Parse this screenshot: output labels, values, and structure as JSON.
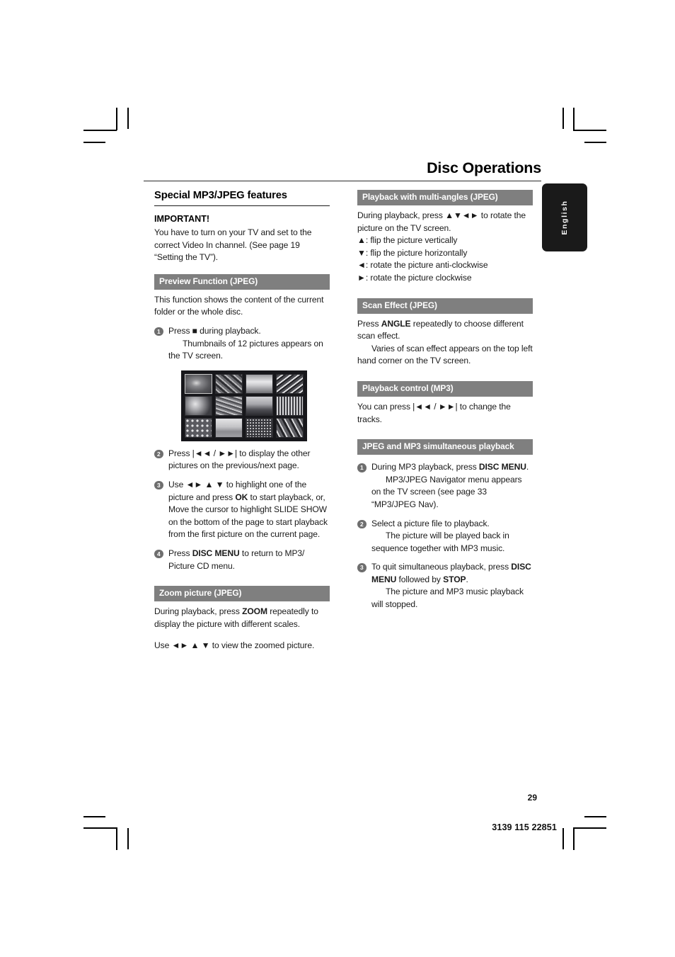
{
  "header": {
    "title": "Disc Operations",
    "language_tab": "English"
  },
  "left_column": {
    "main_title": "Special MP3/JPEG features",
    "important": {
      "heading": "IMPORTANT!",
      "text": "You have to turn on your TV and set to the correct Video In channel.  (See page 19 “Setting the TV”)."
    },
    "preview": {
      "bar": "Preview Function (JPEG)",
      "intro": "This function shows the content of the current folder or the whole disc.",
      "step1_num": "1",
      "step1_main": "Press ■ during playback.",
      "step1_cont": "Thumbnails of 12 pictures appears on",
      "step1_cont2": "the TV screen.",
      "step2_num": "2",
      "step2_text": "Press |◄◄ / ►►| to display the other pictures on the previous/next page.",
      "step3_num": "3",
      "step3_a": "Use ◄► ▲ ▼ to highlight one of the picture and press OK to start playback, or,",
      "step3_b": "Move the cursor to highlight SLIDE SHOW on the bottom of the page to start playback from the first picture on the current page.",
      "step4_num": "4",
      "step4_text": "Press DISC MENU to return to MP3/ Picture CD menu."
    },
    "zoom": {
      "bar": "Zoom picture (JPEG)",
      "text1": "During playback, press ZOOM repeatedly to display the picture with different scales.",
      "text2": "Use ◄► ▲ ▼ to view the zoomed picture."
    },
    "thumbnail_screenshot": {
      "name": "tv-thumbnail-grid",
      "rows": 3,
      "cols": 4,
      "count": 12,
      "selected_index": 1
    }
  },
  "right_column": {
    "multi_angles": {
      "bar": "Playback with multi-angles (JPEG)",
      "intro": "During playback, press ▲▼◄► to rotate the picture on the TV screen.",
      "line1": "▲: flip the picture vertically",
      "line2": "▼: flip the picture horizontally",
      "line3": "◄: rotate the picture anti-clockwise",
      "line4": "►: rotate the picture clockwise"
    },
    "scan_effect": {
      "bar": "Scan Effect (JPEG)",
      "text1": "Press ANGLE repeatedly to choose different scan effect.",
      "text2": "Varies of scan effect appears on the top left hand corner on the TV screen."
    },
    "playback_control": {
      "bar": "Playback control (MP3)",
      "text1": "You can press |◄◄ / ►►| to change the tracks."
    },
    "simultaneous": {
      "bar": "JPEG and MP3 simultaneous playback",
      "step1_num": "1",
      "step1_main": "During MP3 playback, press DISC MENU.",
      "step1_cont": "MP3/JPEG Navigator menu appears on the TV screen (see page 33 “MP3/JPEG Nav).",
      "step2_num": "2",
      "step2_main": "Select a picture file to playback.",
      "step2_cont": "The picture will be played back in sequence together with MP3 music.",
      "step3_num": "3",
      "step3_main": "To quit simultaneous playback, press DISC MENU followed by STOP.",
      "step3_cont": "The picture and MP3 music playback will stopped."
    }
  },
  "footer": {
    "page_number": "29",
    "document_code": "3139 115 22851"
  },
  "colors": {
    "bar_grey": "#7f7f7f",
    "bullet_grey": "#6e6e6e",
    "tab_black": "#1a1a1a"
  }
}
